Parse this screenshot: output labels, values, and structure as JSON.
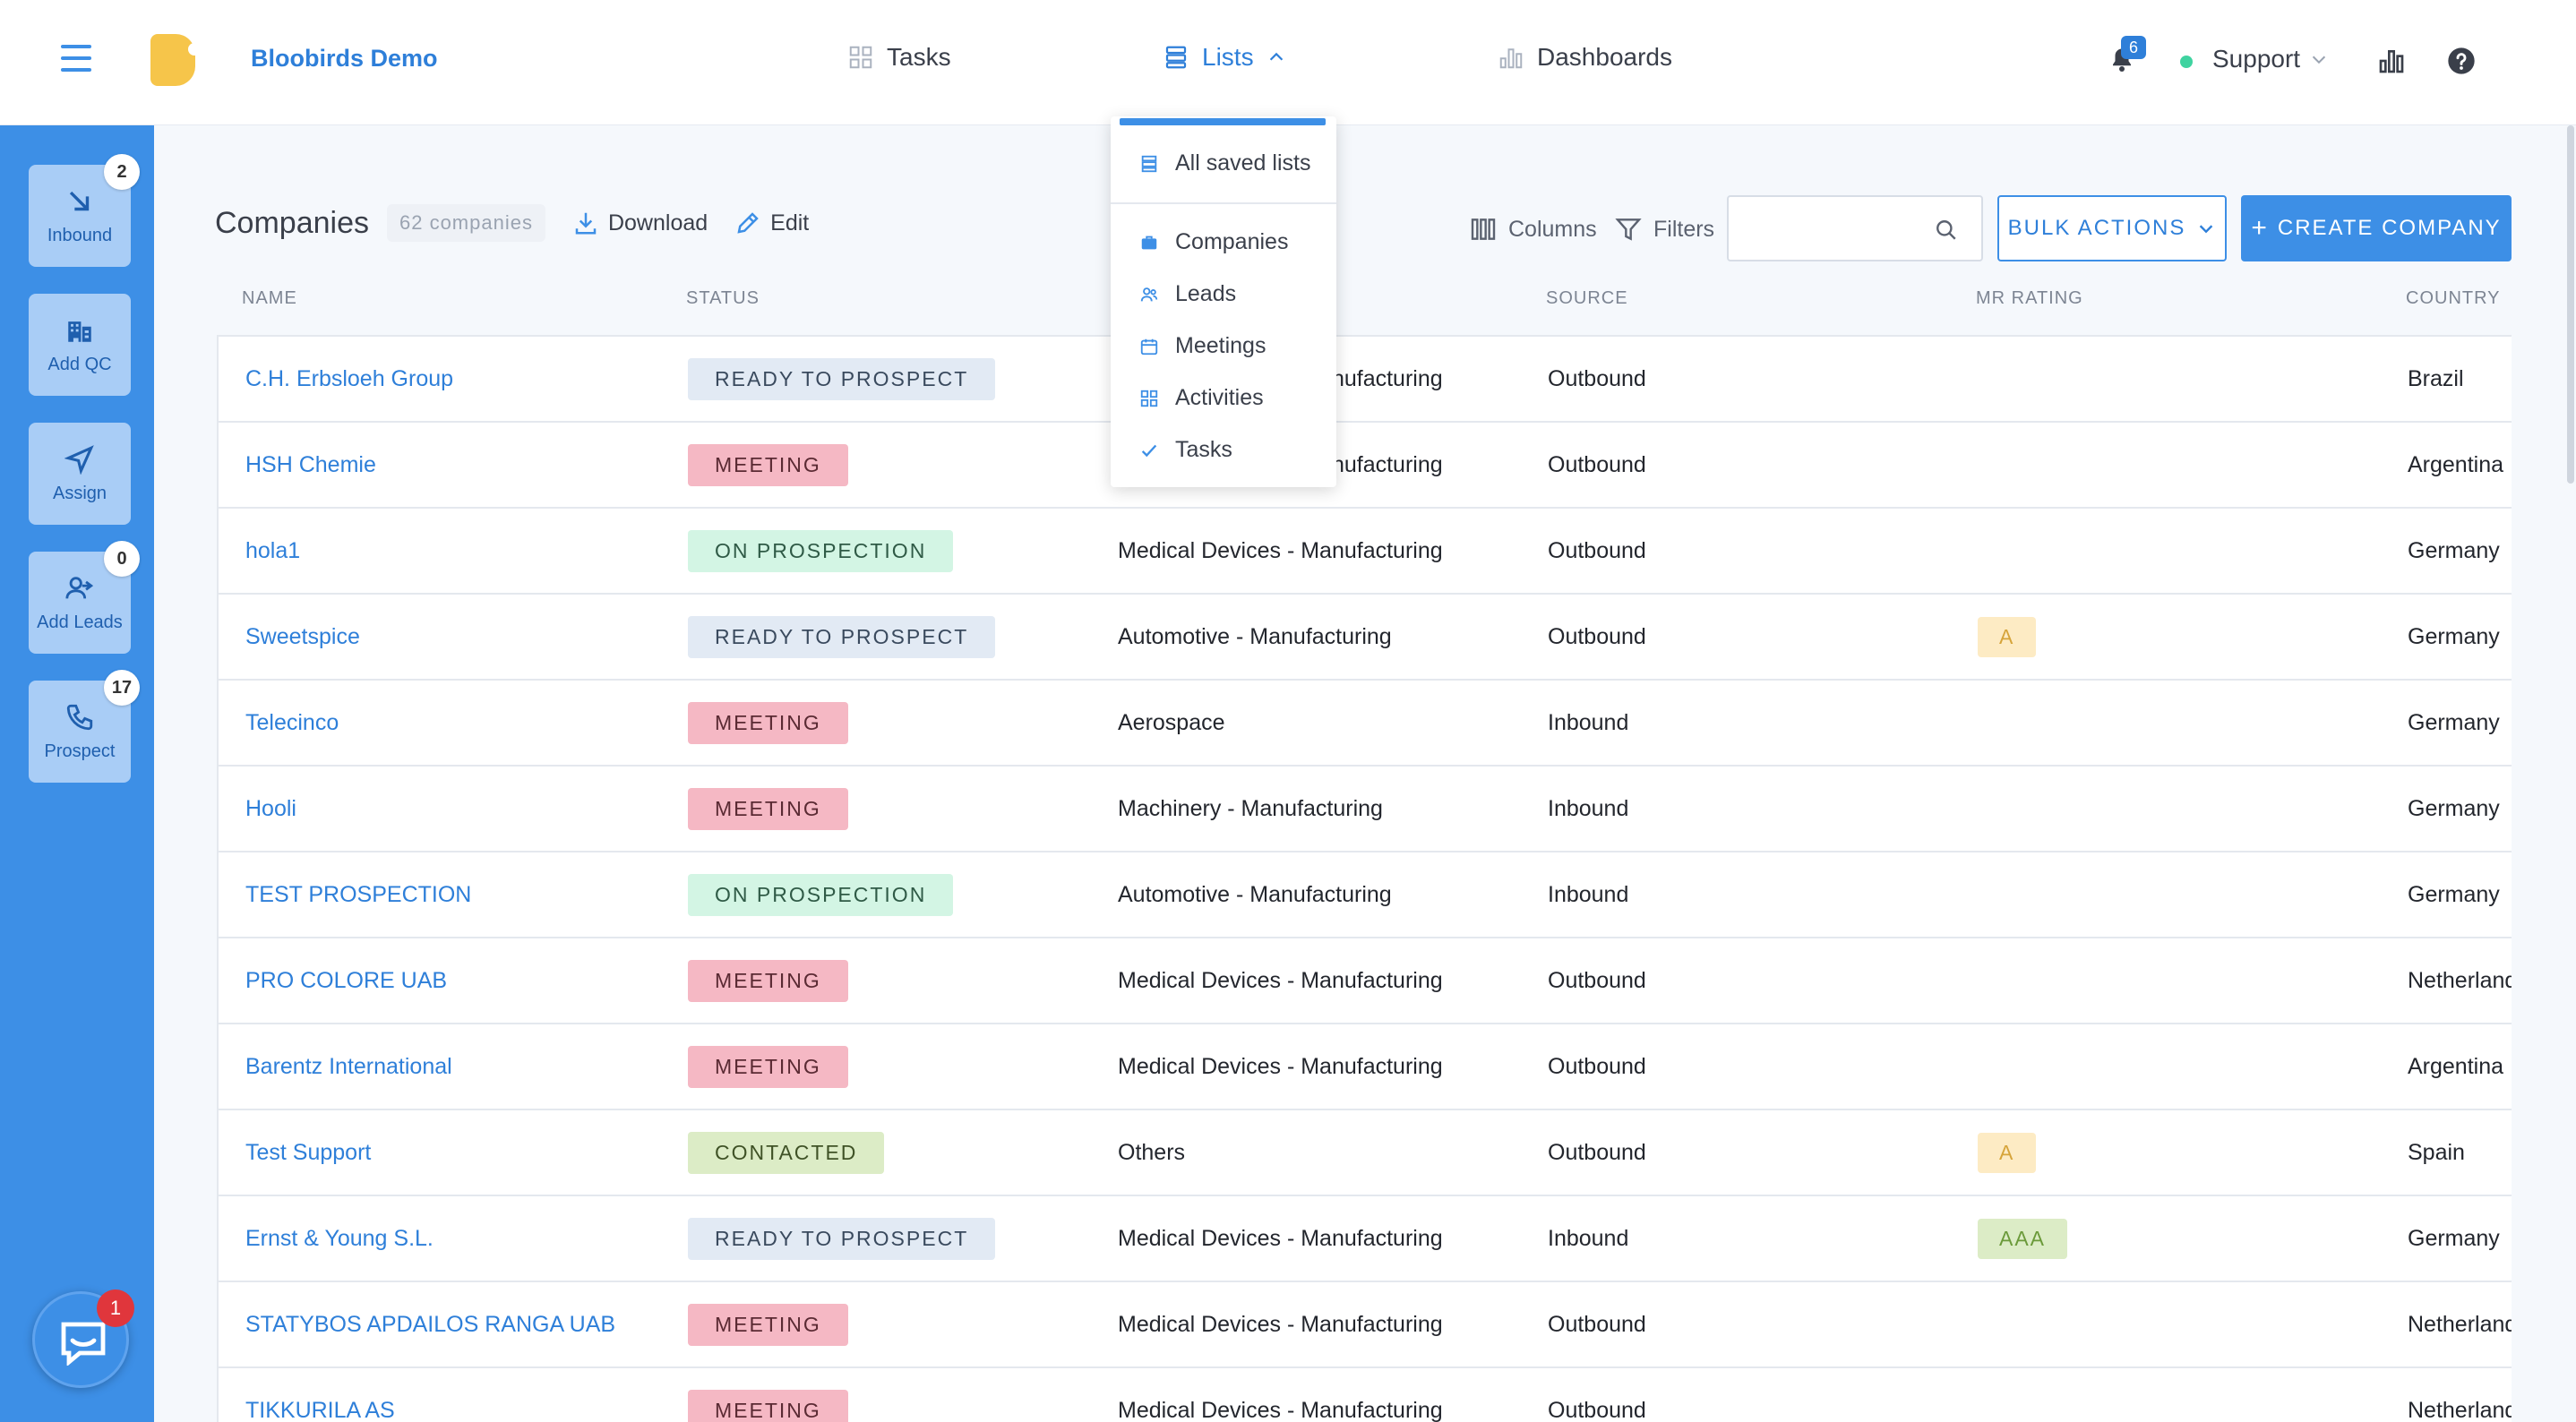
{
  "header": {
    "app_name": "Bloobirds Demo",
    "nav": {
      "tasks": "Tasks",
      "lists": "Lists",
      "dashboards": "Dashboards"
    },
    "notification_count": "6",
    "user_label": "Support"
  },
  "sidebar": {
    "items": [
      {
        "label": "Inbound",
        "badge": "2",
        "icon": "arrow-down-right-icon"
      },
      {
        "label": "Add QC",
        "badge": "",
        "icon": "building-icon"
      },
      {
        "label": "Assign",
        "badge": "",
        "icon": "send-icon"
      },
      {
        "label": "Add Leads",
        "badge": "0",
        "icon": "user-arrow-icon"
      },
      {
        "label": "Prospect",
        "badge": "17",
        "icon": "phone-icon"
      }
    ],
    "chat_badge": "1"
  },
  "lists_menu": {
    "all_saved": "All saved lists",
    "items": [
      "Companies",
      "Leads",
      "Meetings",
      "Activities",
      "Tasks"
    ]
  },
  "page": {
    "title": "Companies",
    "count": "62 companies",
    "download": "Download",
    "edit": "Edit",
    "columns": "Columns",
    "filters": "Filters",
    "search_placeholder": "",
    "bulk_actions": "BULK ACTIONS",
    "create": "CREATE COMPANY"
  },
  "table": {
    "headers": {
      "name": "NAME",
      "status": "STATUS",
      "source": "SOURCE",
      "rating": "MR RATING",
      "country": "COUNTRY"
    },
    "rows": [
      {
        "name": "C.H. Erbsloeh Group",
        "status": "READY TO PROSPECT",
        "industry": "Medical Devices - Manufacturing",
        "source": "Outbound",
        "rating": "",
        "country": "Brazil"
      },
      {
        "name": "HSH Chemie",
        "status": "MEETING",
        "industry": "Medical Devices - Manufacturing",
        "source": "Outbound",
        "rating": "",
        "country": "Argentina"
      },
      {
        "name": "hola1",
        "status": "ON PROSPECTION",
        "industry": "Medical Devices - Manufacturing",
        "source": "Outbound",
        "rating": "",
        "country": "Germany"
      },
      {
        "name": "Sweetspice",
        "status": "READY TO PROSPECT",
        "industry": "Automotive - Manufacturing",
        "source": "Outbound",
        "rating": "A",
        "country": "Germany"
      },
      {
        "name": "Telecinco",
        "status": "MEETING",
        "industry": "Aerospace",
        "source": "Inbound",
        "rating": "",
        "country": "Germany"
      },
      {
        "name": "Hooli",
        "status": "MEETING",
        "industry": "Machinery - Manufacturing",
        "source": "Inbound",
        "rating": "",
        "country": "Germany"
      },
      {
        "name": "TEST PROSPECTION",
        "status": "ON PROSPECTION",
        "industry": "Automotive - Manufacturing",
        "source": "Inbound",
        "rating": "",
        "country": "Germany"
      },
      {
        "name": "PRO COLORE UAB",
        "status": "MEETING",
        "industry": "Medical Devices - Manufacturing",
        "source": "Outbound",
        "rating": "",
        "country": "Netherlands"
      },
      {
        "name": "Barentz International",
        "status": "MEETING",
        "industry": "Medical Devices - Manufacturing",
        "source": "Outbound",
        "rating": "",
        "country": "Argentina"
      },
      {
        "name": "Test Support",
        "status": "CONTACTED",
        "industry": "Others",
        "source": "Outbound",
        "rating": "A",
        "country": "Spain"
      },
      {
        "name": "Ernst & Young S.L.",
        "status": "READY TO PROSPECT",
        "industry": "Medical Devices - Manufacturing",
        "source": "Inbound",
        "rating": "AAA",
        "country": "Germany"
      },
      {
        "name": "STATYBOS APDAILOS RANGA UAB",
        "status": "MEETING",
        "industry": "Medical Devices - Manufacturing",
        "source": "Outbound",
        "rating": "",
        "country": "Netherlands"
      },
      {
        "name": "TIKKURILA AS",
        "status": "MEETING",
        "industry": "Medical Devices - Manufacturing",
        "source": "Outbound",
        "rating": "",
        "country": "Netherlands"
      }
    ]
  },
  "colors": {
    "accent": "#3d8fe6",
    "status": {
      "READY TO PROSPECT": {
        "bg": "#e2eaf4",
        "fg": "#3a4a5e"
      },
      "MEETING": {
        "bg": "#f5b8c4",
        "fg": "#5a2a33"
      },
      "ON PROSPECTION": {
        "bg": "#d3f5e4",
        "fg": "#2f5a46"
      },
      "CONTACTED": {
        "bg": "#dcecc6",
        "fg": "#3f5226"
      }
    },
    "rating": {
      "A": {
        "bg": "#fdebc4",
        "fg": "#d6a43a"
      },
      "AAA": {
        "bg": "#dcecc6",
        "fg": "#6b9a3a"
      }
    }
  }
}
